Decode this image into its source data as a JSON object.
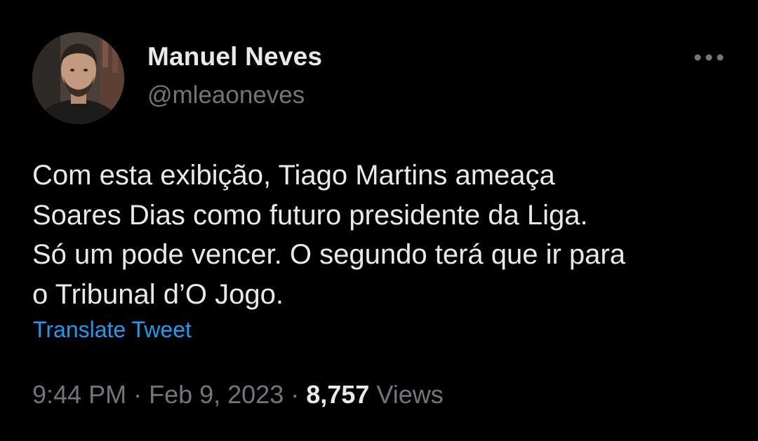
{
  "author": {
    "display_name": "Manuel Neves",
    "handle": "@mleaoneves"
  },
  "more_icon": "more-horizontal-icon",
  "tweet": {
    "lines": [
      "Com esta exibição, Tiago Martins ameaça",
      "Soares Dias como futuro presidente da Liga.",
      "Só um pode vencer. O segundo terá que ir para",
      "o Tribunal d’O Jogo."
    ],
    "translate_label": "Translate Tweet"
  },
  "meta": {
    "time": "9:44 PM",
    "separator": "·",
    "date": "Feb 9, 2023",
    "views_count": "8,757",
    "views_label": "Views"
  },
  "colors": {
    "background": "#000000",
    "primary_text": "#e7e9ea",
    "secondary_text": "#71767b",
    "link": "#1d9bf0"
  }
}
